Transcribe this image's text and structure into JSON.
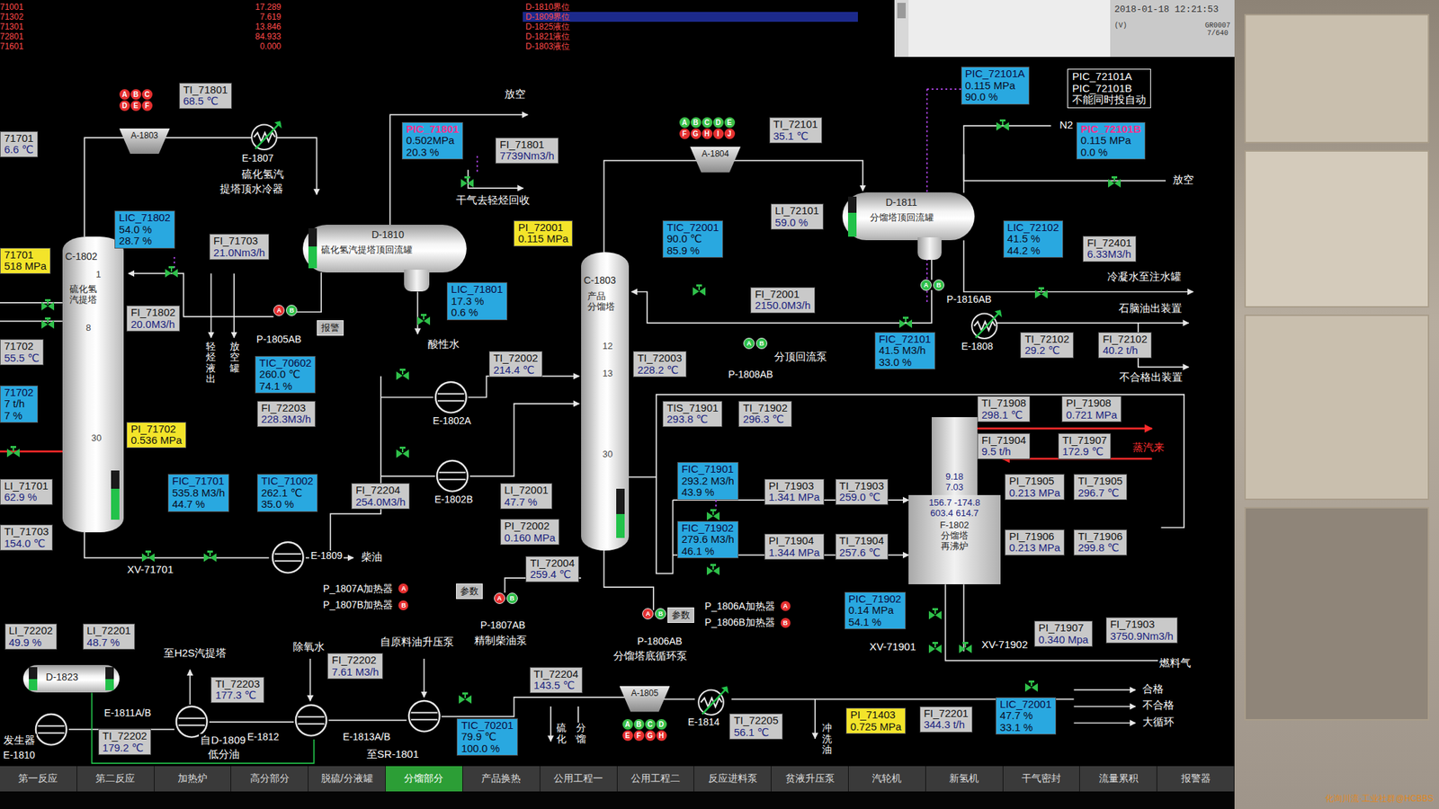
{
  "header": {
    "alarms": [
      {
        "tag": "71001",
        "value": "17.289",
        "event": "D-1810界位",
        "selected": false
      },
      {
        "tag": "71302",
        "value": "7.619",
        "event": "D-1809界位",
        "selected": true
      },
      {
        "tag": "71301",
        "value": "13.846",
        "event": "D-1825液位",
        "selected": false
      },
      {
        "tag": "72801",
        "value": "84.933",
        "event": "D-1821液位",
        "selected": false
      },
      {
        "tag": "71601",
        "value": "0.000",
        "event": "D-1803液位",
        "selected": false
      }
    ],
    "timestamp": "2018-01-18 12:21:53",
    "unit": "(V)",
    "page": "GR0007",
    "count": "7/640"
  },
  "tags": [
    {
      "name": "TI_71801",
      "values": [
        "68.5 ℃"
      ],
      "kind": "indicator",
      "alarm": false
    },
    {
      "name": "71701",
      "values": [
        "6.6 ℃"
      ],
      "kind": "indicator",
      "alarm": false
    },
    {
      "name": "LIC_71802",
      "values": [
        "54.0 %",
        "28.7 %"
      ],
      "kind": "controller",
      "alarm": false
    },
    {
      "name": "FI_71703",
      "values": [
        "21.0Nm3/h"
      ],
      "kind": "indicator",
      "alarm": false
    },
    {
      "name": "71701",
      "values": [
        "518 MPa"
      ],
      "kind": "pressure",
      "alarm": false
    },
    {
      "name": "FI_71802",
      "values": [
        "20.0M3/h"
      ],
      "kind": "indicator",
      "alarm": false
    },
    {
      "name": "71702",
      "values": [
        "55.5 ℃"
      ],
      "kind": "indicator",
      "alarm": false
    },
    {
      "name": "71702",
      "values": [
        "7 t/h",
        "7 %"
      ],
      "kind": "controller",
      "alarm": false
    },
    {
      "name": "PI_71702",
      "values": [
        "0.536 MPa"
      ],
      "kind": "pressure",
      "alarm": false
    },
    {
      "name": "FIC_71701",
      "values": [
        "535.8 M3/h",
        "44.7 %"
      ],
      "kind": "controller",
      "alarm": false
    },
    {
      "name": "TIC_71002",
      "values": [
        "262.1 ℃",
        "35.0 %"
      ],
      "kind": "controller",
      "alarm": false
    },
    {
      "name": "TIC_70602",
      "values": [
        "260.0 ℃",
        "74.1 %"
      ],
      "kind": "controller",
      "alarm": false
    },
    {
      "name": "FI_72203",
      "values": [
        "228.3M3/h"
      ],
      "kind": "indicator",
      "alarm": false
    },
    {
      "name": "LI_71701",
      "values": [
        "62.9 %"
      ],
      "kind": "indicator",
      "alarm": false
    },
    {
      "name": "TI_71703",
      "values": [
        "154.0 ℃"
      ],
      "kind": "indicator",
      "alarm": false
    },
    {
      "name": "PIC_71801",
      "values": [
        "0.502MPa",
        "20.3 %"
      ],
      "kind": "controller",
      "alarm": true
    },
    {
      "name": "FI_71801",
      "values": [
        "7739Nm3/h"
      ],
      "kind": "indicator",
      "alarm": false
    },
    {
      "name": "PI_72001",
      "values": [
        "0.115 MPa"
      ],
      "kind": "pressure",
      "alarm": false
    },
    {
      "name": "LIC_71801",
      "values": [
        "17.3 %",
        "0.6 %"
      ],
      "kind": "controller",
      "alarm": false
    },
    {
      "name": "TI_72002",
      "values": [
        "214.4 ℃"
      ],
      "kind": "indicator",
      "alarm": false
    },
    {
      "name": "TI_72003",
      "values": [
        "228.2 ℃"
      ],
      "kind": "indicator",
      "alarm": false
    },
    {
      "name": "FI_72204",
      "values": [
        "254.0M3/h"
      ],
      "kind": "indicator",
      "alarm": false
    },
    {
      "name": "LI_72001",
      "values": [
        "47.7 %"
      ],
      "kind": "indicator",
      "alarm": false
    },
    {
      "name": "PI_72002",
      "values": [
        "0.160 MPa"
      ],
      "kind": "indicator",
      "alarm": false
    },
    {
      "name": "TI_72004",
      "values": [
        "259.4 ℃"
      ],
      "kind": "indicator",
      "alarm": false
    },
    {
      "name": "TI_72101",
      "values": [
        "35.1 ℃"
      ],
      "kind": "indicator",
      "alarm": false
    },
    {
      "name": "TIC_72001",
      "values": [
        "90.0 ℃",
        "85.9 %"
      ],
      "kind": "controller",
      "alarm": false
    },
    {
      "name": "LI_72101",
      "values": [
        "59.0 %"
      ],
      "kind": "indicator",
      "alarm": false
    },
    {
      "name": "FI_72001",
      "values": [
        "2150.0M3/h"
      ],
      "kind": "indicator",
      "alarm": false
    },
    {
      "name": "PIC_72101A",
      "values": [
        "0.115 MPa",
        "90.0 %"
      ],
      "kind": "controller",
      "alarm": false
    },
    {
      "name": "PIC_72101B",
      "values": [
        "0.115 MPa",
        "0.0 %"
      ],
      "kind": "controller",
      "alarm": true
    },
    {
      "name": "LIC_72102",
      "values": [
        "41.5 %",
        "44.2 %"
      ],
      "kind": "controller",
      "alarm": false
    },
    {
      "name": "FI_72401",
      "values": [
        "6.33M3/h"
      ],
      "kind": "indicator",
      "alarm": false
    },
    {
      "name": "FIC_72101",
      "values": [
        "41.5 M3/h",
        "33.0 %"
      ],
      "kind": "controller",
      "alarm": false
    },
    {
      "name": "TI_72102",
      "values": [
        "29.2 ℃"
      ],
      "kind": "indicator",
      "alarm": false
    },
    {
      "name": "FI_72102",
      "values": [
        "40.2 t/h"
      ],
      "kind": "indicator",
      "alarm": false
    },
    {
      "name": "TIS_71901",
      "values": [
        "293.8 ℃"
      ],
      "kind": "indicator",
      "alarm": false
    },
    {
      "name": "TI_71902",
      "values": [
        "296.3 ℃"
      ],
      "kind": "indicator",
      "alarm": false
    },
    {
      "name": "TI_71908",
      "values": [
        "298.1 ℃"
      ],
      "kind": "indicator",
      "alarm": false
    },
    {
      "name": "PI_71908",
      "values": [
        "0.721 MPa"
      ],
      "kind": "indicator",
      "alarm": false
    },
    {
      "name": "FI_71904",
      "values": [
        "9.5 t/h"
      ],
      "kind": "indicator",
      "alarm": false
    },
    {
      "name": "TI_71907",
      "values": [
        "172.9 ℃"
      ],
      "kind": "indicator",
      "alarm": false
    },
    {
      "name": "FIC_71901",
      "values": [
        "293.2 M3/h",
        "43.9 %"
      ],
      "kind": "controller",
      "alarm": false
    },
    {
      "name": "PI_71903",
      "values": [
        "1.341 MPa"
      ],
      "kind": "indicator",
      "alarm": false
    },
    {
      "name": "TI_71903",
      "values": [
        "259.0 ℃"
      ],
      "kind": "indicator",
      "alarm": false
    },
    {
      "name": "PI_71905",
      "values": [
        "0.213 MPa"
      ],
      "kind": "indicator",
      "alarm": false
    },
    {
      "name": "TI_71905",
      "values": [
        "296.7 ℃"
      ],
      "kind": "indicator",
      "alarm": false
    },
    {
      "name": "FIC_71902",
      "values": [
        "279.6 M3/h",
        "46.1 %"
      ],
      "kind": "controller",
      "alarm": false
    },
    {
      "name": "PI_71904",
      "values": [
        "1.344 MPa"
      ],
      "kind": "indicator",
      "alarm": false
    },
    {
      "name": "TI_71904",
      "values": [
        "257.6 ℃"
      ],
      "kind": "indicator",
      "alarm": false
    },
    {
      "name": "PI_71906",
      "values": [
        "0.213 MPa"
      ],
      "kind": "indicator",
      "alarm": false
    },
    {
      "name": "TI_71906",
      "values": [
        "299.8 ℃"
      ],
      "kind": "indicator",
      "alarm": false
    },
    {
      "name": "PIC_71902",
      "values": [
        "0.14 MPa",
        "54.1 %"
      ],
      "kind": "controller",
      "alarm": false
    },
    {
      "name": "PI_71907",
      "values": [
        "0.340 Mpa"
      ],
      "kind": "indicator",
      "alarm": false
    },
    {
      "name": "FI_71903",
      "values": [
        "3750.9Nm3/h"
      ],
      "kind": "indicator",
      "alarm": false
    },
    {
      "name": "LI_72202",
      "values": [
        "49.9 %"
      ],
      "kind": "indicator",
      "alarm": false
    },
    {
      "name": "LI_72201",
      "values": [
        "48.7 %"
      ],
      "kind": "indicator",
      "alarm": false
    },
    {
      "name": "TI_72203",
      "values": [
        "177.3 ℃"
      ],
      "kind": "indicator",
      "alarm": false
    },
    {
      "name": "FI_72202",
      "values": [
        "7.61 M3/h"
      ],
      "kind": "indicator",
      "alarm": false
    },
    {
      "name": "TI_72202",
      "values": [
        "179.2 ℃"
      ],
      "kind": "indicator",
      "alarm": false
    },
    {
      "name": "TI_72204",
      "values": [
        "143.5 ℃"
      ],
      "kind": "indicator",
      "alarm": false
    },
    {
      "name": "TIC_70201",
      "values": [
        "79.9 ℃",
        "100.0 %"
      ],
      "kind": "controller",
      "alarm": false
    },
    {
      "name": "TI_72205",
      "values": [
        "56.1 ℃"
      ],
      "kind": "indicator",
      "alarm": false
    },
    {
      "name": "PI_71403",
      "values": [
        "0.725 MPa"
      ],
      "kind": "pressure",
      "alarm": false
    },
    {
      "name": "FI_72201",
      "values": [
        "344.3 t/h"
      ],
      "kind": "indicator",
      "alarm": false
    },
    {
      "name": "LIC_72001",
      "values": [
        "47.7 %",
        "33.1 %"
      ],
      "kind": "controller",
      "alarm": false
    }
  ],
  "note": [
    "PIC_72101A",
    "PIC_72101B",
    "不能同时投自动"
  ],
  "equipment": [
    {
      "name": "C-1802",
      "kind": "column",
      "desc": [
        "硫化氢",
        "汽提塔"
      ],
      "levels": [
        0.63
      ]
    },
    {
      "name": "C-1803",
      "kind": "column",
      "desc": [
        "产品",
        "分馏塔"
      ],
      "levels": [
        0.48
      ]
    },
    {
      "name": "D-1810",
      "kind": "drum",
      "desc": [
        "硫化氢汽提塔顶回流罐"
      ],
      "levels": [
        0.55
      ]
    },
    {
      "name": "D-1811",
      "kind": "drum",
      "desc": [
        "分馏塔顶回流罐"
      ],
      "levels": [
        0.59
      ]
    },
    {
      "name": "D-1823",
      "kind": "drum",
      "desc": [],
      "levels": [
        0.5,
        0.49
      ]
    },
    {
      "name": "F-1802",
      "kind": "heater",
      "desc": [
        "分馏塔",
        "再沸炉"
      ],
      "readings": [
        "156.7 -174.8",
        "603.4 614.7"
      ],
      "stack": [
        "9.18",
        "7.03"
      ]
    },
    {
      "name": "E-1807",
      "kind": "cooler",
      "desc": []
    },
    {
      "name": "E-1808",
      "kind": "cooler",
      "desc": []
    },
    {
      "name": "E-1814",
      "kind": "cooler",
      "desc": []
    },
    {
      "name": "E-1802A",
      "kind": "exchanger",
      "desc": []
    },
    {
      "name": "E-1802B",
      "kind": "exchanger",
      "desc": []
    },
    {
      "name": "E-1809",
      "kind": "exchanger",
      "desc": []
    },
    {
      "name": "E-1811A/B",
      "kind": "exchanger",
      "desc": []
    },
    {
      "name": "E-1812",
      "kind": "exchanger",
      "desc": []
    },
    {
      "name": "E-1813A/B",
      "kind": "exchanger",
      "desc": []
    },
    {
      "name": "E-1810",
      "kind": "exchanger",
      "desc": []
    }
  ],
  "analyzers": [
    {
      "name": "A-1803",
      "points": [
        {
          "label": "A",
          "color": "#e53030"
        },
        {
          "label": "B",
          "color": "#e53030"
        },
        {
          "label": "C",
          "color": "#e53030"
        },
        {
          "label": "D",
          "color": "#e53030"
        },
        {
          "label": "E",
          "color": "#e53030"
        },
        {
          "label": "F",
          "color": "#e53030"
        }
      ]
    },
    {
      "name": "A-1804",
      "points": [
        {
          "label": "A",
          "color": "#3cc04a"
        },
        {
          "label": "B",
          "color": "#3cc04a"
        },
        {
          "label": "C",
          "color": "#3cc04a"
        },
        {
          "label": "D",
          "color": "#3cc04a"
        },
        {
          "label": "E",
          "color": "#3cc04a"
        },
        {
          "label": "F",
          "color": "#e53030"
        },
        {
          "label": "G",
          "color": "#e53030"
        },
        {
          "label": "H",
          "color": "#e53030"
        },
        {
          "label": "I",
          "color": "#e53030"
        },
        {
          "label": "J",
          "color": "#e53030"
        }
      ]
    },
    {
      "name": "A-1805",
      "points": [
        {
          "label": "A",
          "color": "#3cc04a"
        },
        {
          "label": "B",
          "color": "#3cc04a"
        },
        {
          "label": "C",
          "color": "#3cc04a"
        },
        {
          "label": "D",
          "color": "#3cc04a"
        },
        {
          "label": "E",
          "color": "#e53030"
        },
        {
          "label": "F",
          "color": "#e53030"
        },
        {
          "label": "G",
          "color": "#e53030"
        },
        {
          "label": "H",
          "color": "#e53030"
        }
      ]
    }
  ],
  "pumps": [
    {
      "name": "P-1805AB",
      "units": [
        {
          "label": "A",
          "color": "#e53030"
        },
        {
          "label": "B",
          "color": "#2fbf4a"
        }
      ]
    },
    {
      "name": "P-1808AB",
      "units": [
        {
          "label": "A",
          "color": "#2fbf4a"
        },
        {
          "label": "B",
          "color": "#2fbf4a"
        }
      ]
    },
    {
      "name": "P-1816AB",
      "units": [
        {
          "label": "A",
          "color": "#2fbf4a"
        },
        {
          "label": "B",
          "color": "#2fbf4a"
        }
      ]
    },
    {
      "name": "P-1807AB",
      "units": [
        {
          "label": "A",
          "color": "#e53030"
        },
        {
          "label": "B",
          "color": "#2fbf4a"
        }
      ]
    },
    {
      "name": "P-1806AB",
      "units": [
        {
          "label": "A",
          "color": "#e53030"
        },
        {
          "label": "B",
          "color": "#2fbf4a"
        }
      ]
    }
  ],
  "switches": [
    {
      "label": "P_1807A加热器",
      "mark": "A",
      "color": "#e53030"
    },
    {
      "label": "P_1807B加热器",
      "mark": "B",
      "color": "#e53030"
    },
    {
      "label": "P_1806A加热器",
      "mark": "A",
      "color": "#e53030"
    },
    {
      "label": "P_1806B加热器",
      "mark": "B",
      "color": "#e53030"
    }
  ],
  "buttons": [
    {
      "label": "报警"
    },
    {
      "label": "参数"
    },
    {
      "label": "参数"
    }
  ],
  "labels": [
    {
      "text": "放空",
      "kind": "plain",
      "color": "#ffffff"
    },
    {
      "text": "硫化氢汽",
      "kind": "plain",
      "color": "#ffffff"
    },
    {
      "text": "提塔顶水冷器",
      "kind": "plain",
      "color": "#ffffff"
    },
    {
      "text": "干气去轻烃回收",
      "kind": "plain",
      "color": "#ffffff"
    },
    {
      "text": "轻烃液出",
      "kind": "vertical",
      "color": "#ffffff"
    },
    {
      "text": "放空罐",
      "kind": "vertical",
      "color": "#ffffff"
    },
    {
      "text": "酸性水",
      "kind": "plain",
      "color": "#ffffff"
    },
    {
      "text": "柴油",
      "kind": "plain",
      "color": "#ffffff"
    },
    {
      "text": "XV-71701",
      "kind": "plain",
      "color": "#ffffff"
    },
    {
      "text": "分顶回流泵",
      "kind": "plain",
      "color": "#ffffff"
    },
    {
      "text": "N2",
      "kind": "plain",
      "color": "#ffffff"
    },
    {
      "text": "放空",
      "kind": "plain",
      "color": "#ffffff"
    },
    {
      "text": "冷凝水至注水罐",
      "kind": "plain",
      "color": "#ffffff"
    },
    {
      "text": "石脑油出装置",
      "kind": "plain",
      "color": "#ffffff"
    },
    {
      "text": "不合格出装置",
      "kind": "plain",
      "color": "#ffffff"
    },
    {
      "text": "蒸汽来",
      "kind": "plain",
      "color": "#ff3030"
    },
    {
      "text": "XV-71901",
      "kind": "plain",
      "color": "#ffffff"
    },
    {
      "text": "XV-71902",
      "kind": "plain",
      "color": "#ffffff"
    },
    {
      "text": "燃料气",
      "kind": "plain",
      "color": "#ffffff"
    },
    {
      "text": "合格",
      "kind": "plain",
      "color": "#ffffff"
    },
    {
      "text": "不合格",
      "kind": "plain",
      "color": "#ffffff"
    },
    {
      "text": "大循环",
      "kind": "plain",
      "color": "#ffffff"
    },
    {
      "text": "精制柴油泵",
      "kind": "plain",
      "color": "#ffffff"
    },
    {
      "text": "分馏塔底循环泵",
      "kind": "plain",
      "color": "#ffffff"
    },
    {
      "text": "至H2S汽提塔",
      "kind": "plain",
      "color": "#ffffff"
    },
    {
      "text": "除氧水",
      "kind": "plain",
      "color": "#ffffff"
    },
    {
      "text": "自原料油升压泵",
      "kind": "plain",
      "color": "#ffffff"
    },
    {
      "text": "至SR-1801",
      "kind": "plain",
      "color": "#ffffff"
    },
    {
      "text": "自D-1809",
      "kind": "plain",
      "color": "#ffffff"
    },
    {
      "text": "低分油",
      "kind": "plain",
      "color": "#ffffff"
    },
    {
      "text": "硫化",
      "kind": "vertical",
      "color": "#ffffff"
    },
    {
      "text": "分馏",
      "kind": "vertical",
      "color": "#ffffff"
    },
    {
      "text": "冲洗油",
      "kind": "vertical",
      "color": "#ffffff"
    },
    {
      "text": "发生器",
      "kind": "plain",
      "color": "#ffffff"
    },
    {
      "text": "1",
      "kind": "tray",
      "color": "#444444"
    },
    {
      "text": "8",
      "kind": "tray",
      "color": "#444444"
    },
    {
      "text": "30",
      "kind": "tray",
      "color": "#444444"
    },
    {
      "text": "12",
      "kind": "tray",
      "color": "#444444"
    },
    {
      "text": "13",
      "kind": "tray",
      "color": "#444444"
    },
    {
      "text": "30",
      "kind": "tray",
      "color": "#444444"
    }
  ],
  "tabs": [
    {
      "label": "第一反应",
      "selected": false
    },
    {
      "label": "第二反应",
      "selected": false
    },
    {
      "label": "加热炉",
      "selected": false
    },
    {
      "label": "高分部分",
      "selected": false
    },
    {
      "label": "脱硫/分液罐",
      "selected": false
    },
    {
      "label": "分馏部分",
      "selected": true
    },
    {
      "label": "产品换热",
      "selected": false
    },
    {
      "label": "公用工程一",
      "selected": false
    },
    {
      "label": "公用工程二",
      "selected": false
    },
    {
      "label": "反应进料泵",
      "selected": false
    },
    {
      "label": "贫液升压泵",
      "selected": false
    },
    {
      "label": "汽轮机",
      "selected": false
    },
    {
      "label": "新氢机",
      "selected": false
    },
    {
      "label": "干气密封",
      "selected": false
    },
    {
      "label": "流量累积",
      "selected": false
    },
    {
      "label": "报警器",
      "selected": false
    }
  ],
  "watermark": "化询川流·工业社群@HCBBS"
}
